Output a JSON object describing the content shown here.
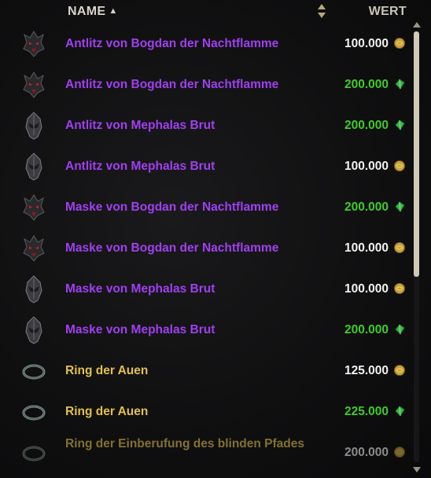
{
  "header": {
    "name_label": "NAME",
    "value_label": "WERT",
    "sort_indicator": "▲"
  },
  "items": [
    {
      "name": "Antlitz von Bogdan der Nachtflamme",
      "price": "100.000",
      "quality": "purple",
      "price_color": "#f2f2f2",
      "currency": "gold-coin-icon",
      "icon": "bogdan-helm-icon"
    },
    {
      "name": "Antlitz von Bogdan der Nachtflamme",
      "price": "200.000",
      "quality": "purple",
      "price_color": "#3fcc29",
      "currency": "crown-gem-icon",
      "icon": "bogdan-helm-icon"
    },
    {
      "name": "Antlitz von Mephalas Brut",
      "price": "200.000",
      "quality": "purple",
      "price_color": "#3fcc29",
      "currency": "crown-gem-icon",
      "icon": "mephala-helm-icon"
    },
    {
      "name": "Antlitz von Mephalas Brut",
      "price": "100.000",
      "quality": "purple",
      "price_color": "#f2f2f2",
      "currency": "gold-coin-icon",
      "icon": "mephala-helm-icon"
    },
    {
      "name": "Maske von Bogdan der Nachtflamme",
      "price": "200.000",
      "quality": "purple",
      "price_color": "#3fcc29",
      "currency": "crown-gem-icon",
      "icon": "bogdan-helm-icon"
    },
    {
      "name": "Maske von Bogdan der Nachtflamme",
      "price": "100.000",
      "quality": "purple",
      "price_color": "#f2f2f2",
      "currency": "gold-coin-icon",
      "icon": "bogdan-helm-icon"
    },
    {
      "name": "Maske von Mephalas Brut",
      "price": "100.000",
      "quality": "purple",
      "price_color": "#f2f2f2",
      "currency": "gold-coin-icon",
      "icon": "mephala-helm-icon"
    },
    {
      "name": "Maske von Mephalas Brut",
      "price": "200.000",
      "quality": "purple",
      "price_color": "#3fcc29",
      "currency": "crown-gem-icon",
      "icon": "mephala-helm-icon"
    },
    {
      "name": "Ring der Auen",
      "price": "125.000",
      "quality": "gold",
      "price_color": "#f2f2f2",
      "currency": "gold-coin-icon",
      "icon": "ring-icon"
    },
    {
      "name": "Ring der Auen",
      "price": "225.000",
      "quality": "gold",
      "price_color": "#3fcc29",
      "currency": "crown-gem-icon",
      "icon": "ring-icon"
    },
    {
      "name": "Ring der Einberufung des blinden Pfades",
      "price": "200.000",
      "quality": "gold",
      "price_color": "#f2f2f2",
      "currency": "gold-coin-icon",
      "icon": "ring-icon",
      "faded": true
    }
  ],
  "colors": {
    "purple_quality": "#a03ff0",
    "gold_quality": "#e2c04c",
    "green_price": "#3fcc29",
    "white_price": "#f2f2f2"
  }
}
